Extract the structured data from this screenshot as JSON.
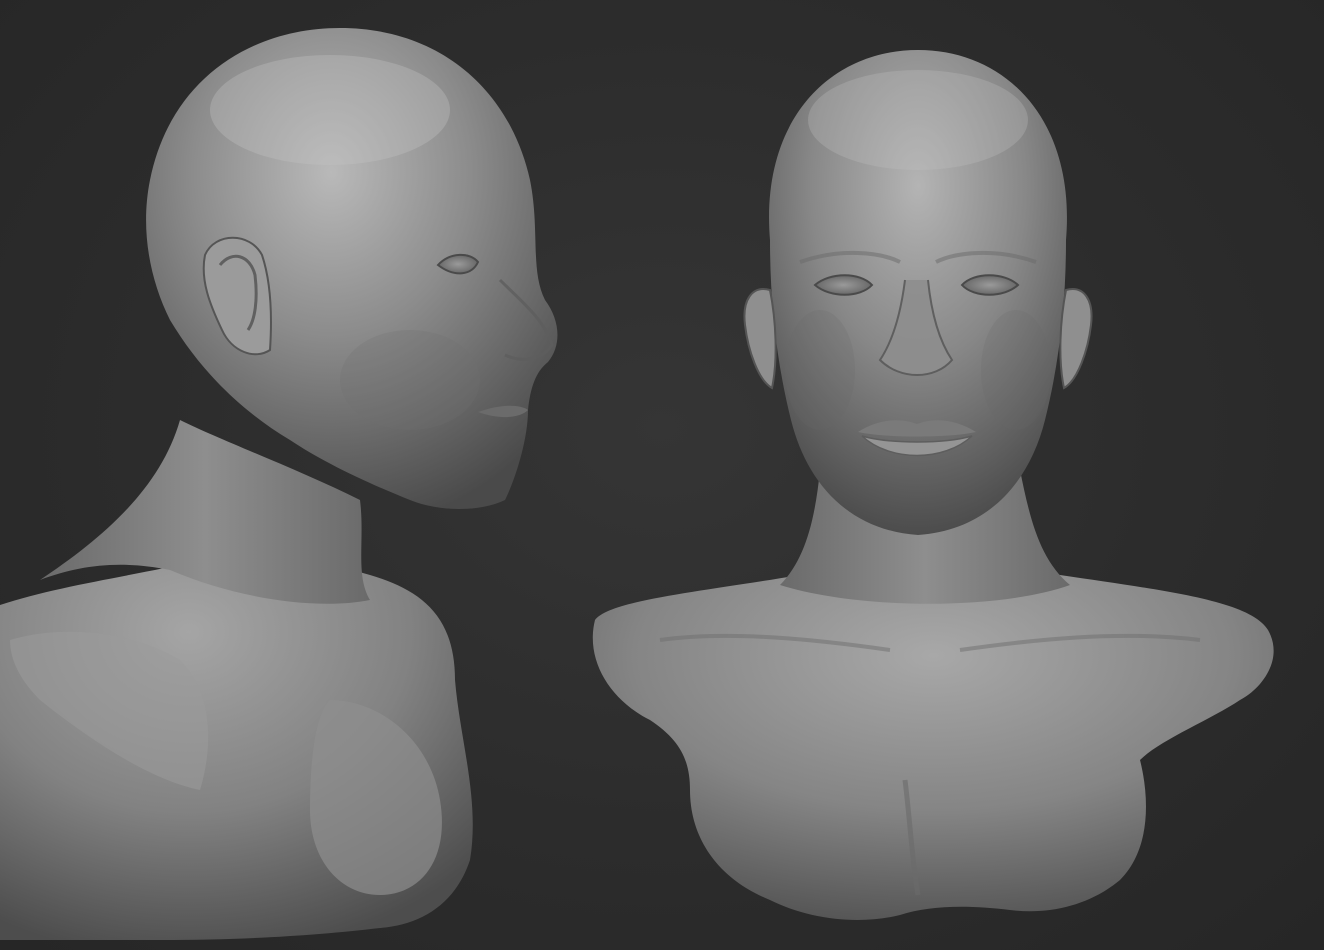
{
  "scene": {
    "background_color": "#2b2b2b",
    "material_color": "#8a8a8a",
    "views": [
      {
        "id": "three-quarter-view",
        "description_icon": "sculpt-bust-icon"
      },
      {
        "id": "front-view",
        "description_icon": "sculpt-bust-icon"
      }
    ]
  }
}
